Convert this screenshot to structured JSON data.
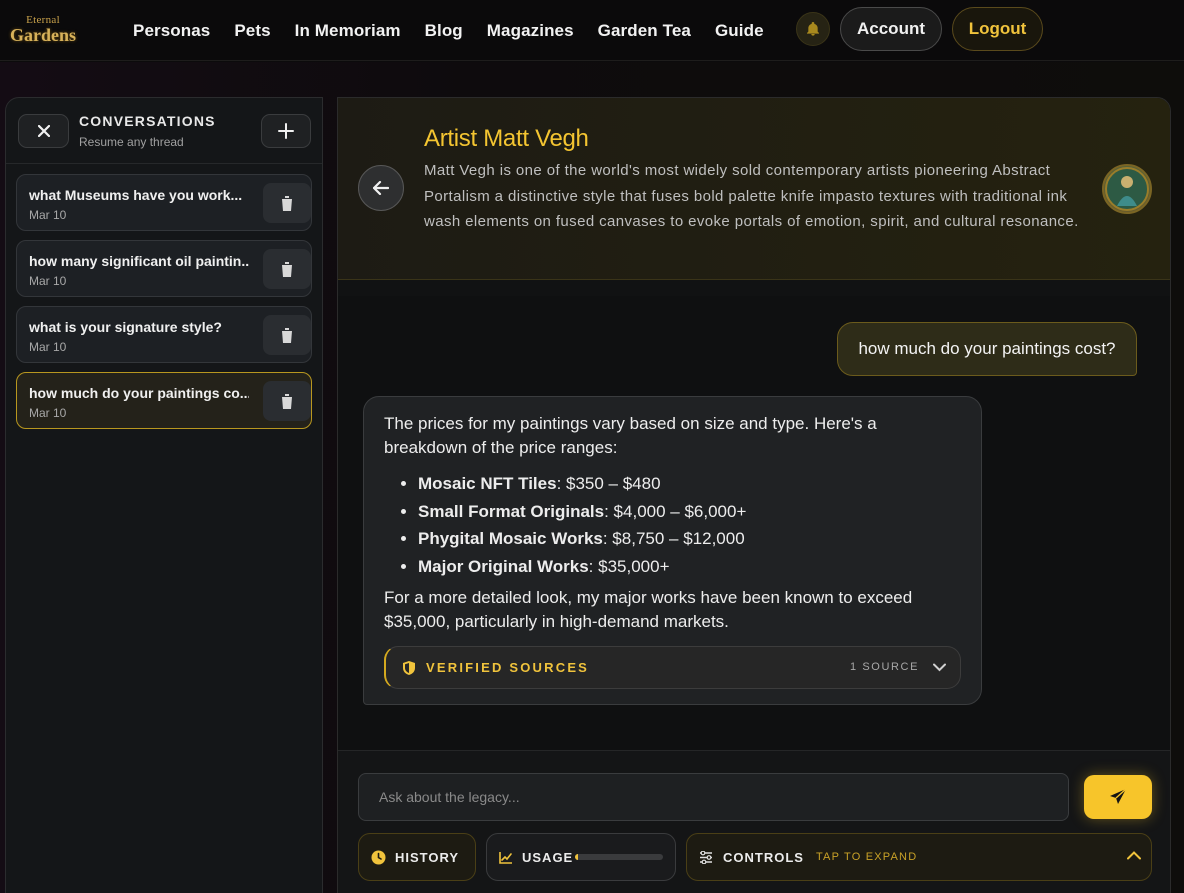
{
  "brand": {
    "line1": "Eternal",
    "line2": "Gardens"
  },
  "nav": [
    "Personas",
    "Pets",
    "In Memoriam",
    "Blog",
    "Magazines",
    "Garden Tea",
    "Guide"
  ],
  "account_label": "Account",
  "logout_label": "Logout",
  "sidebar": {
    "title": "CONVERSATIONS",
    "subtitle": "Resume any thread",
    "conversations": [
      {
        "title": "what Museums have you work...",
        "date": "Mar 10"
      },
      {
        "title": "how many significant oil paintin...",
        "date": "Mar 10"
      },
      {
        "title": "what is your signature style?",
        "date": "Mar 10"
      },
      {
        "title": "how much do your paintings co...",
        "date": "Mar 10"
      }
    ]
  },
  "persona": {
    "name": "Artist Matt Vegh",
    "description": "Matt Vegh is one of the world's most widely sold contemporary artists pioneering Abstract Portalism a distinctive style that fuses bold palette knife impasto textures with traditional ink wash elements on fused canvases to evoke portals of emotion, spirit, and cultural resonance."
  },
  "chat": {
    "user_message": "how much do your paintings cost?",
    "reply_intro": "The prices for my paintings vary based on size and type. Here's a breakdown of the price ranges:",
    "price_list": [
      {
        "label": "Mosaic NFT Tiles",
        "value": ": $350 – $480"
      },
      {
        "label": "Small Format Originals",
        "value": ": $4,000 – $6,000+"
      },
      {
        "label": "Phygital Mosaic Works",
        "value": ": $8,750 – $12,000"
      },
      {
        "label": "Major Original Works",
        "value": ": $35,000+"
      }
    ],
    "reply_outro": "For a more detailed look, my major works have been known to exceed $35,000, particularly in high-demand markets.",
    "verified_label": "VERIFIED SOURCES",
    "source_count": "1 SOURCE"
  },
  "composer": {
    "placeholder": "Ask about the legacy...",
    "history_label": "HISTORY",
    "usage_label": "USAGE",
    "usage_fraction": 0.03,
    "controls_label": "CONTROLS",
    "controls_hint": "TAP TO EXPAND"
  },
  "colors": {
    "accent": "#f4c531",
    "background": "#0c0b0c",
    "panel": "#141618"
  }
}
